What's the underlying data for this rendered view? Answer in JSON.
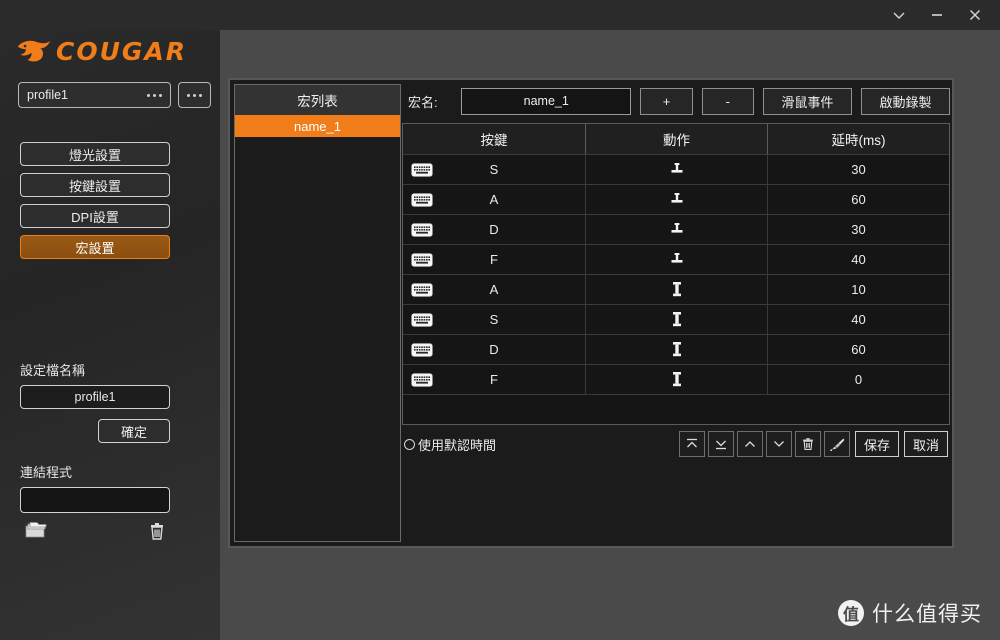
{
  "window": {
    "controls": [
      {
        "name": "collapse",
        "glyph": "chevron-down-icon"
      },
      {
        "name": "minimize",
        "glyph": "minimize-icon"
      },
      {
        "name": "close",
        "glyph": "close-icon"
      }
    ]
  },
  "brand": {
    "name": "COUGAR",
    "accent": "#f07d1a"
  },
  "sidebar": {
    "profile": {
      "value": "profile1",
      "menu_icon": "ellipsis-icon"
    },
    "nav": [
      {
        "label": "燈光設置",
        "active": false
      },
      {
        "label": "按鍵設置",
        "active": false
      },
      {
        "label": "DPI設置",
        "active": false
      },
      {
        "label": "宏設置",
        "active": true
      }
    ],
    "profile_name": {
      "label": "設定檔名稱",
      "value": "profile1",
      "confirm_label": "確定"
    },
    "linked_program": {
      "label": "連結程式",
      "value": "",
      "placeholder": "",
      "browse_icon": "folder-icon",
      "delete_icon": "trash-icon"
    }
  },
  "main": {
    "macro_list": {
      "header": "宏列表",
      "items": [
        {
          "label": "name_1",
          "selected": true
        }
      ]
    },
    "toolbar": {
      "name_label": "宏名:",
      "name_value": "name_1",
      "add_label": "+",
      "remove_label": "-",
      "mouse_event_label": "滑鼠事件",
      "record_label": "啟動錄製"
    },
    "table": {
      "columns": [
        "按鍵",
        "動作",
        "延時(ms)"
      ],
      "rows": [
        {
          "device": "keyboard-icon",
          "key": "S",
          "action": "key-down",
          "delay": "30"
        },
        {
          "device": "keyboard-icon",
          "key": "A",
          "action": "key-down",
          "delay": "60"
        },
        {
          "device": "keyboard-icon",
          "key": "D",
          "action": "key-down",
          "delay": "30"
        },
        {
          "device": "keyboard-icon",
          "key": "F",
          "action": "key-down",
          "delay": "40"
        },
        {
          "device": "keyboard-icon",
          "key": "A",
          "action": "key-up",
          "delay": "10"
        },
        {
          "device": "keyboard-icon",
          "key": "S",
          "action": "key-up",
          "delay": "40"
        },
        {
          "device": "keyboard-icon",
          "key": "D",
          "action": "key-up",
          "delay": "60"
        },
        {
          "device": "keyboard-icon",
          "key": "F",
          "action": "key-up",
          "delay": "0"
        }
      ]
    },
    "footer": {
      "default_time_label": "使用默認時間",
      "default_time_checked": false,
      "actions": [
        {
          "name": "move-to-top",
          "icon": "chevron-up-bar-icon"
        },
        {
          "name": "move-to-bottom",
          "icon": "chevron-down-bar-icon"
        },
        {
          "name": "move-up",
          "icon": "chevron-up-icon"
        },
        {
          "name": "move-down",
          "icon": "chevron-down-icon"
        },
        {
          "name": "delete-row",
          "icon": "trash-icon"
        },
        {
          "name": "clear-all",
          "icon": "brush-icon"
        }
      ],
      "save_label": "保存",
      "cancel_label": "取消"
    }
  },
  "watermark": {
    "badge": "值",
    "text": "什么值得买"
  }
}
